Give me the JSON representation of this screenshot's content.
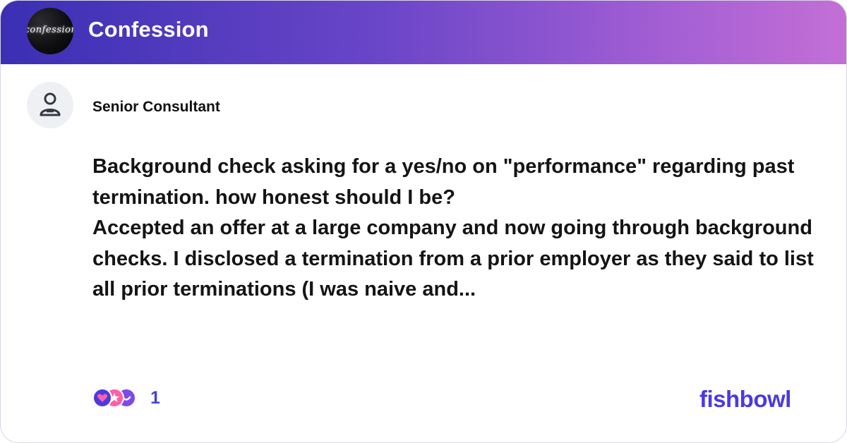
{
  "header": {
    "logo_text": "confession",
    "bowl_name": "Confession"
  },
  "author": {
    "title": "Senior Consultant",
    "avatar_icon": "person-icon"
  },
  "post": {
    "title": "Background check asking for a yes/no on \"performance\" regarding past termination. how honest should I be?",
    "body": "Accepted an offer at a large company and now going through background checks. I disclosed a termination from a prior employer as they said to list all prior terminations (I was naive and..."
  },
  "footer": {
    "reaction_icons": [
      "heart-reaction-icon",
      "star-reaction-icon",
      "laugh-reaction-icon"
    ],
    "reaction_count": "1",
    "brand": "fishbowl"
  },
  "colors": {
    "header_gradient_start": "#3b2fb4",
    "header_gradient_end": "#c46fd6",
    "brand": "#4b3ae0",
    "count": "#4a3fcf"
  }
}
